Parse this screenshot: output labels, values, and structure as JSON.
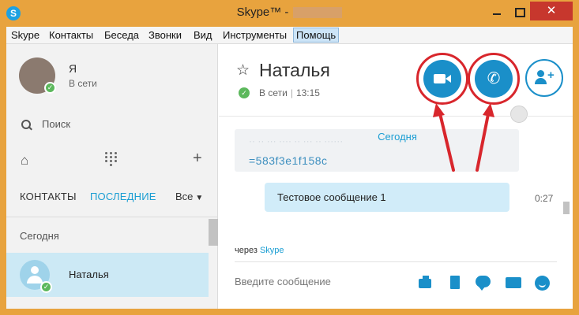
{
  "window": {
    "title": "Skype™ -",
    "app_icon": "skype-icon",
    "close_glyph": "✕"
  },
  "menu": {
    "items": [
      "Skype",
      "Контакты",
      "Беседа",
      "Звонки",
      "Вид",
      "Инструменты",
      "Помощь"
    ],
    "active": "Помощь"
  },
  "profile": {
    "name": "Я",
    "status": "В сети"
  },
  "search": {
    "label": "Поиск"
  },
  "tabs": {
    "contacts": "КОНТАКТЫ",
    "recent": "ПОСЛЕДНИЕ",
    "filter": "Все"
  },
  "recent": {
    "section": "Сегодня",
    "items": [
      {
        "name": "Наталья",
        "status_color": "#5cb85c"
      }
    ]
  },
  "chat": {
    "name": "Наталья",
    "status": "В сети",
    "local_time": "13:15",
    "date_label": "Сегодня",
    "old_message": "=583f3e1f158c",
    "messages": [
      {
        "text": "Тестовое сообщение 1",
        "time": "0:27"
      }
    ],
    "via_prefix": "через",
    "via_link": "Skype",
    "input_placeholder": "Введите сообщение"
  },
  "colors": {
    "accent": "#1a8fc9",
    "link": "#1b9ed3",
    "online": "#5cb85c",
    "highlight_ring": "#d8262c",
    "window_frame": "#e8a33e"
  },
  "icons": {
    "star": "☆",
    "home": "⌂",
    "plus": "+",
    "phone": "✆",
    "check": "✓",
    "chevron": "▼"
  }
}
